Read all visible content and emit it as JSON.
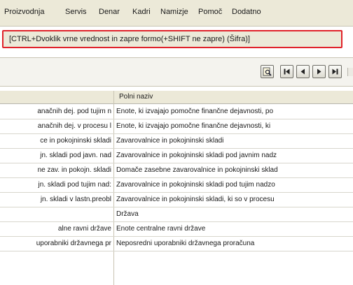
{
  "menu": [
    "Proizvodnja",
    "Servis",
    "Denar",
    "Kadri",
    "Namizje",
    "Pomoč",
    "Dodatno"
  ],
  "hint": "[CTRL+Dvoklik vrne vrednost in zapre formo(+SHIFT ne zapre) (Šifra)]",
  "toolbar": {
    "buttons": [
      "find-icon",
      "first-record-icon",
      "previous-record-icon",
      "next-record-icon",
      "last-record-icon"
    ]
  },
  "table": {
    "columns": [
      "",
      "Polni naziv"
    ],
    "rows": [
      [
        "anačnih dej. pod tujim n",
        "Enote, ki izvajajo pomočne finančne dejavnosti, po"
      ],
      [
        "anačnih dej. v procesu l",
        "Enote, ki izvajajo pomočne finančne dejavnosti, ki"
      ],
      [
        "ce in pokojninski skladi",
        "Zavarovalnice in pokojninski skladi"
      ],
      [
        "jn. skladi pod javn. nad",
        "Zavarovalnice in pokojninski skladi pod javnim nadz"
      ],
      [
        "ne zav. in pokojn. skladi",
        "Domače zasebne zavarovalnice in pokojninski sklad"
      ],
      [
        "jn. skladi pod tujim nad:",
        "Zavarovalnice in pokojninski skladi pod tujim nadzo"
      ],
      [
        "jn. skladi v lastn.preobl",
        "Zavarovalnice in pokojninski skladi, ki so v procesu"
      ],
      [
        "",
        "Država"
      ],
      [
        "alne ravni države",
        "Enote centralne ravni države"
      ],
      [
        "uporabniki državnega pr",
        "Neposredni uporabniki državnega proračuna"
      ]
    ]
  }
}
